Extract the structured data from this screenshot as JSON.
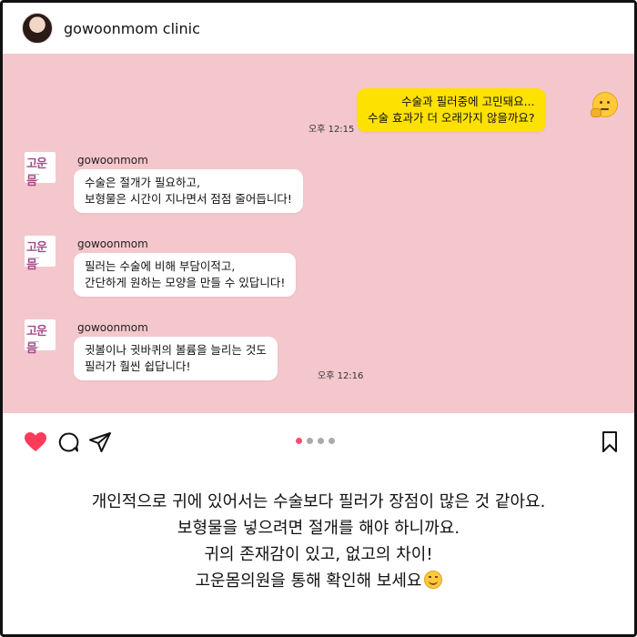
{
  "header": {
    "account_name": "gowoonmom clinic"
  },
  "chat": {
    "outgoing": {
      "lines": [
        "수술과 필러중에 고민돼요...",
        "수술 효과가 더 오래가지 않을까요?"
      ],
      "time": "오후 12:15",
      "emoji": "thinking-face"
    },
    "incoming": [
      {
        "sender": "gowoonmom",
        "lines": [
          "수술은 절개가 필요하고,",
          "보형물은 시간이 지나면서 점점 줄어듭니다!"
        ]
      },
      {
        "sender": "gowoonmom",
        "lines": [
          "필러는 수술에 비해 부담이적고,",
          "간단하게 원하는 모양을 만들 수 있답니다!"
        ]
      },
      {
        "sender": "gowoonmom",
        "lines": [
          "귓볼이나 귓바퀴의 볼륨을 늘리는 것도",
          "필러가 훨씬 쉽답니다!"
        ],
        "time": "오후 12:16"
      }
    ],
    "logo_text": "고운몸"
  },
  "actions": {
    "icons": [
      "heart-icon",
      "comment-icon",
      "share-icon",
      "bookmark-icon"
    ],
    "carousel": {
      "count": 4,
      "active_index": 0
    },
    "colors": {
      "heart": "#ff3b5c",
      "chat_bg": "#f4c7cd",
      "outgoing_bubble": "#fde100"
    }
  },
  "caption": {
    "lines": [
      "개인적으로 귀에 있어서는 수술보다 필러가 장점이 많은 것 같아요.",
      "보형물을 넣으려면 절개를 해야 하니까요.",
      "귀의 존재감이 있고, 없고의 차이!",
      "고운몸의원을 통해 확인해 보세요"
    ],
    "end_emoji": "smiling-face"
  }
}
